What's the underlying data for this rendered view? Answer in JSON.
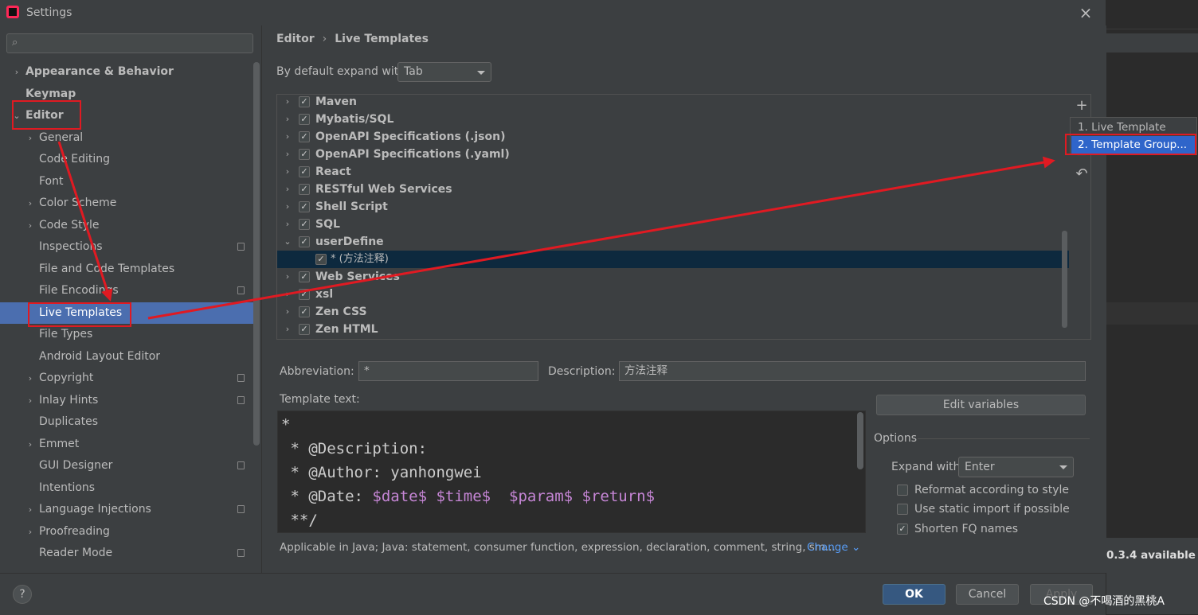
{
  "window": {
    "title": "Settings",
    "close_glyph": "×"
  },
  "search": {
    "placeholder": ""
  },
  "sidebar": {
    "items": [
      {
        "label": "Appearance & Behavior",
        "bold": true,
        "arrow": "›",
        "badge": false
      },
      {
        "label": "Keymap",
        "bold": true,
        "arrow": "",
        "badge": false
      },
      {
        "label": "Editor",
        "bold": true,
        "arrow": "⌄",
        "badge": false
      },
      {
        "label": "General",
        "bold": false,
        "arrow": "›",
        "badge": false
      },
      {
        "label": "Code Editing",
        "bold": false,
        "arrow": "",
        "badge": false
      },
      {
        "label": "Font",
        "bold": false,
        "arrow": "",
        "badge": false
      },
      {
        "label": "Color Scheme",
        "bold": false,
        "arrow": "›",
        "badge": false
      },
      {
        "label": "Code Style",
        "bold": false,
        "arrow": "›",
        "badge": false
      },
      {
        "label": "Inspections",
        "bold": false,
        "arrow": "",
        "badge": true
      },
      {
        "label": "File and Code Templates",
        "bold": false,
        "arrow": "",
        "badge": false
      },
      {
        "label": "File Encodings",
        "bold": false,
        "arrow": "",
        "badge": true
      },
      {
        "label": "Live Templates",
        "bold": false,
        "arrow": "",
        "badge": false,
        "selected": true
      },
      {
        "label": "File Types",
        "bold": false,
        "arrow": "",
        "badge": false
      },
      {
        "label": "Android Layout Editor",
        "bold": false,
        "arrow": "",
        "badge": false
      },
      {
        "label": "Copyright",
        "bold": false,
        "arrow": "›",
        "badge": true
      },
      {
        "label": "Inlay Hints",
        "bold": false,
        "arrow": "›",
        "badge": true
      },
      {
        "label": "Duplicates",
        "bold": false,
        "arrow": "",
        "badge": false
      },
      {
        "label": "Emmet",
        "bold": false,
        "arrow": "›",
        "badge": false
      },
      {
        "label": "GUI Designer",
        "bold": false,
        "arrow": "",
        "badge": true
      },
      {
        "label": "Intentions",
        "bold": false,
        "arrow": "",
        "badge": false
      },
      {
        "label": "Language Injections",
        "bold": false,
        "arrow": "›",
        "badge": true
      },
      {
        "label": "Proofreading",
        "bold": false,
        "arrow": "›",
        "badge": false
      },
      {
        "label": "Reader Mode",
        "bold": false,
        "arrow": "",
        "badge": true
      }
    ]
  },
  "breadcrumb": {
    "parent": "Editor",
    "separator": "›",
    "current": "Live Templates"
  },
  "expand_default": {
    "label": "By default expand with",
    "value": "Tab"
  },
  "template_groups": [
    {
      "name": "Maven",
      "checked": true,
      "expanded": false
    },
    {
      "name": "Mybatis/SQL",
      "checked": true,
      "expanded": false
    },
    {
      "name": "OpenAPI Specifications (.json)",
      "checked": true,
      "expanded": false
    },
    {
      "name": "OpenAPI Specifications (.yaml)",
      "checked": true,
      "expanded": false
    },
    {
      "name": "React",
      "checked": true,
      "expanded": false
    },
    {
      "name": "RESTful Web Services",
      "checked": true,
      "expanded": false
    },
    {
      "name": "Shell Script",
      "checked": true,
      "expanded": false
    },
    {
      "name": "SQL",
      "checked": true,
      "expanded": false
    },
    {
      "name": "userDefine",
      "checked": true,
      "expanded": true
    },
    {
      "name": "* (方法注释)",
      "checked": true,
      "child": true
    },
    {
      "name": "Web Services",
      "checked": true,
      "expanded": false
    },
    {
      "name": "xsl",
      "checked": true,
      "expanded": false
    },
    {
      "name": "Zen CSS",
      "checked": true,
      "expanded": false
    },
    {
      "name": "Zen HTML",
      "checked": true,
      "expanded": false
    }
  ],
  "toolbar": {
    "add_glyph": "+",
    "remove_glyph": "−",
    "undo_glyph": "↶"
  },
  "add_popup": {
    "items": [
      "1. Live Template",
      "2. Template Group..."
    ]
  },
  "abbreviation": {
    "label": "Abbreviation:",
    "value": "*"
  },
  "description": {
    "label": "Description:",
    "value": "方法注释"
  },
  "template_text": {
    "label": "Template text:",
    "lines": [
      "*",
      " * @Description:",
      " * @Author: yanhongwei",
      " * @Date: $date$ $time$  $param$ $return$",
      " **/"
    ],
    "date_prefix": " * @Date: ",
    "vars": [
      "$date$",
      "$time$",
      "$param$",
      "$return$"
    ]
  },
  "edit_variables": {
    "label": "Edit variables"
  },
  "options": {
    "title": "Options",
    "expand_with_label": "Expand with",
    "expand_with_value": "Enter",
    "checks": [
      {
        "label": "Reformat according to style",
        "checked": false
      },
      {
        "label": "Use static import if possible",
        "checked": false
      },
      {
        "label": "Shorten FQ names",
        "checked": true
      }
    ]
  },
  "applicable": {
    "text": "Applicable in Java; Java: statement, consumer function, expression, declaration, comment, string, sm...",
    "change": "Change ⌄"
  },
  "buttons": {
    "help": "?",
    "ok": "OK",
    "cancel": "Cancel",
    "apply": "Apply"
  },
  "right_side": {
    "update_text": "0.3.4 available"
  },
  "watermark": "CSDN @不喝酒的黑桃A",
  "colors": {
    "selection": "#4b6eaf",
    "annotation_red": "#e01a22",
    "template_var": "#c686d6",
    "link": "#589df6"
  }
}
